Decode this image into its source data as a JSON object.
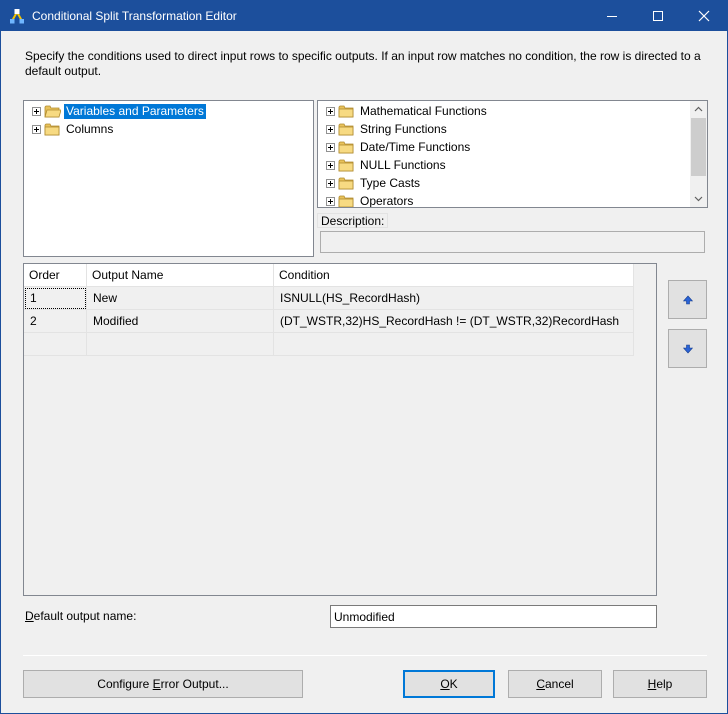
{
  "window": {
    "title": "Conditional Split Transformation Editor"
  },
  "intro_text": "Specify the conditions used to direct input rows to specific outputs. If an input row matches no condition, the row is directed to a default output.",
  "left_tree": {
    "items": [
      {
        "label": "Variables and Parameters",
        "selected": true
      },
      {
        "label": "Columns",
        "selected": false
      }
    ]
  },
  "right_tree": {
    "items": [
      {
        "label": "Mathematical Functions"
      },
      {
        "label": "String Functions"
      },
      {
        "label": "Date/Time Functions"
      },
      {
        "label": "NULL Functions"
      },
      {
        "label": "Type Casts"
      },
      {
        "label": "Operators"
      }
    ]
  },
  "description": {
    "label": "Description:",
    "value": ""
  },
  "grid": {
    "headers": {
      "order": "Order",
      "name": "Output Name",
      "condition": "Condition"
    },
    "rows": [
      {
        "order": "1",
        "name": "New",
        "condition": "ISNULL(HS_RecordHash)"
      },
      {
        "order": "2",
        "name": "Modified",
        "condition": "(DT_WSTR,32)HS_RecordHash != (DT_WSTR,32)RecordHash"
      },
      {
        "order": "",
        "name": "",
        "condition": ""
      }
    ]
  },
  "default_output": {
    "label_prefix": "D",
    "label_rest": "efault output name:",
    "value": "Unmodified"
  },
  "buttons": {
    "config_pre": "Configure ",
    "config_u": "E",
    "config_post": "rror Output...",
    "ok_u": "O",
    "ok_post": "K",
    "cancel_pre": "",
    "cancel_u": "C",
    "cancel_post": "ancel",
    "help_u": "H",
    "help_post": "elp"
  },
  "colors": {
    "titlebar": "#1c4f9c",
    "selection": "#0078d7",
    "folder": "#e8c25b"
  },
  "icons": {
    "app": "conditional-split-icon",
    "folder": "folder-icon",
    "expand": "plus-expander-icon",
    "move_up": "arrow-up-icon",
    "move_down": "arrow-down-icon"
  }
}
